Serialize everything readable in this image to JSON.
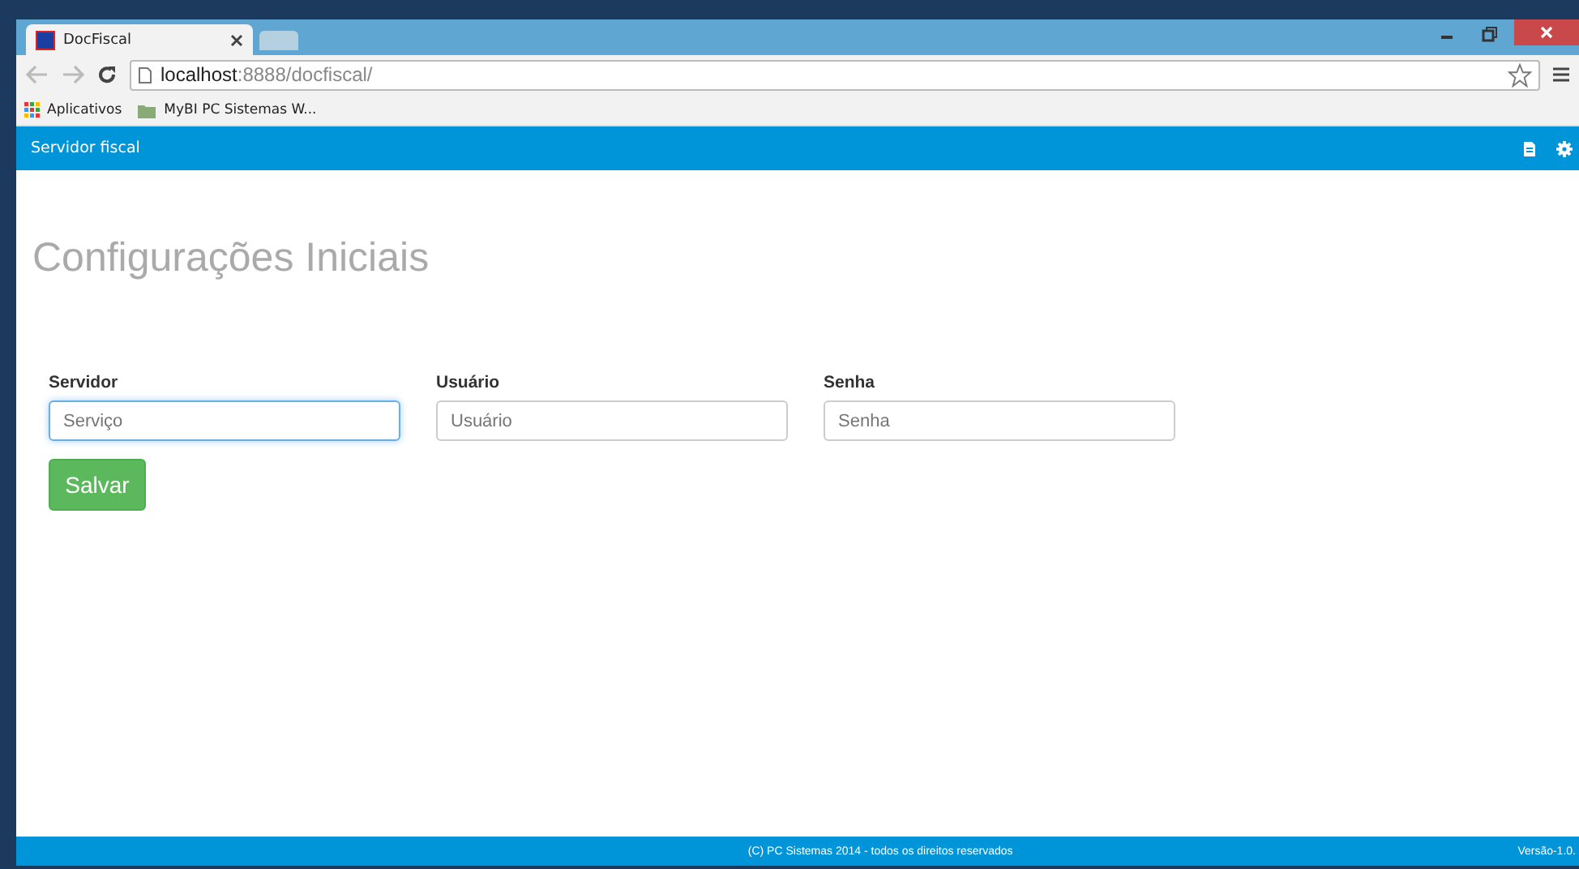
{
  "browser": {
    "tabs": [
      {
        "kind": "page",
        "title": "DocFiscal",
        "selected": true
      },
      {
        "kind": "new",
        "selected": false
      }
    ],
    "url_host": "localhost",
    "url_path": ":8888/docfiscal/",
    "bookmarks": [
      {
        "kind": "apps",
        "label": "Aplicativos"
      },
      {
        "kind": "folder",
        "label": "MyBI PC Sistemas W..."
      }
    ]
  },
  "navbar": {
    "brand": "Servidor fiscal"
  },
  "page": {
    "title": "Configurações Iniciais",
    "fields": [
      {
        "label": "Servidor",
        "placeholder": "Serviço",
        "focused": true
      },
      {
        "label": "Usuário",
        "placeholder": "Usuário",
        "focused": false
      },
      {
        "label": "Senha",
        "placeholder": "Senha",
        "focused": false
      }
    ],
    "save_button": "Salvar"
  },
  "footer": {
    "copyright": "(C) PC Sistemas 2014 - todos os direitos reservados",
    "version": "Versão-1.0."
  }
}
